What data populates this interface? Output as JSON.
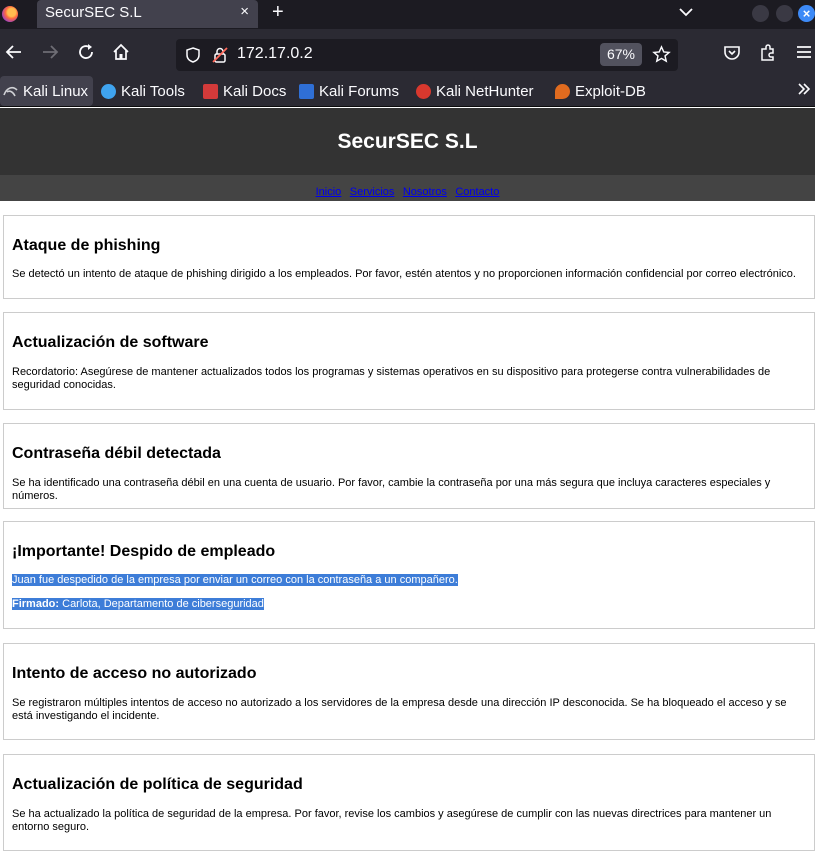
{
  "browser": {
    "tab_title": "SecurSEC S.L",
    "tab_close": "×",
    "new_tab": "+",
    "url": "172.17.0.2",
    "zoom": "67%",
    "window_close": "×"
  },
  "bookmarks": [
    {
      "label": "Kali Linux",
      "color": "#cfd0d4"
    },
    {
      "label": "Kali Tools",
      "color": "#3fa3ef"
    },
    {
      "label": "Kali Docs",
      "color": "#d33a3a"
    },
    {
      "label": "Kali Forums",
      "color": "#2f6fd6"
    },
    {
      "label": "Kali NetHunter",
      "color": "#d8382e"
    },
    {
      "label": "Exploit-DB",
      "color": "#e06b1f"
    }
  ],
  "site": {
    "title": "SecurSEC S.L",
    "nav": [
      "Inicio",
      "Servicios",
      "Nosotros",
      "Contacto"
    ]
  },
  "cards": [
    {
      "title": "Ataque de phishing",
      "text": "Se detectó un intento de ataque de phishing dirigido a los empleados. Por favor, estén atentos y no proporcionen información confidencial por correo electrónico."
    },
    {
      "title": "Actualización de software",
      "text": "Recordatorio: Asegúrese de mantener actualizados todos los programas y sistemas operativos en su dispositivo para protegerse contra vulnerabilidades de seguridad conocidas."
    },
    {
      "title": "Contraseña débil detectada",
      "text": "Se ha identificado una contraseña débil en una cuenta de usuario. Por favor, cambie la contraseña por una más segura que incluya caracteres especiales y números."
    },
    {
      "title": "¡Importante! Despido de empleado",
      "text": "Juan fue despedido de la empresa por enviar un correo con la contraseña a un compañero.",
      "signed_label": "Firmado:",
      "signed_text": " Carlota, Departamento de ciberseguridad"
    },
    {
      "title": "Intento de acceso no autorizado",
      "text": "Se registraron múltiples intentos de acceso no autorizado a los servidores de la empresa desde una dirección IP desconocida. Se ha bloqueado el acceso y se está investigando el incidente."
    },
    {
      "title": "Actualización de política de seguridad",
      "text": "Se ha actualizado la política de seguridad de la empresa. Por favor, revise los cambios y asegúrese de cumplir con las nuevas directrices para mantener un entorno seguro."
    }
  ]
}
